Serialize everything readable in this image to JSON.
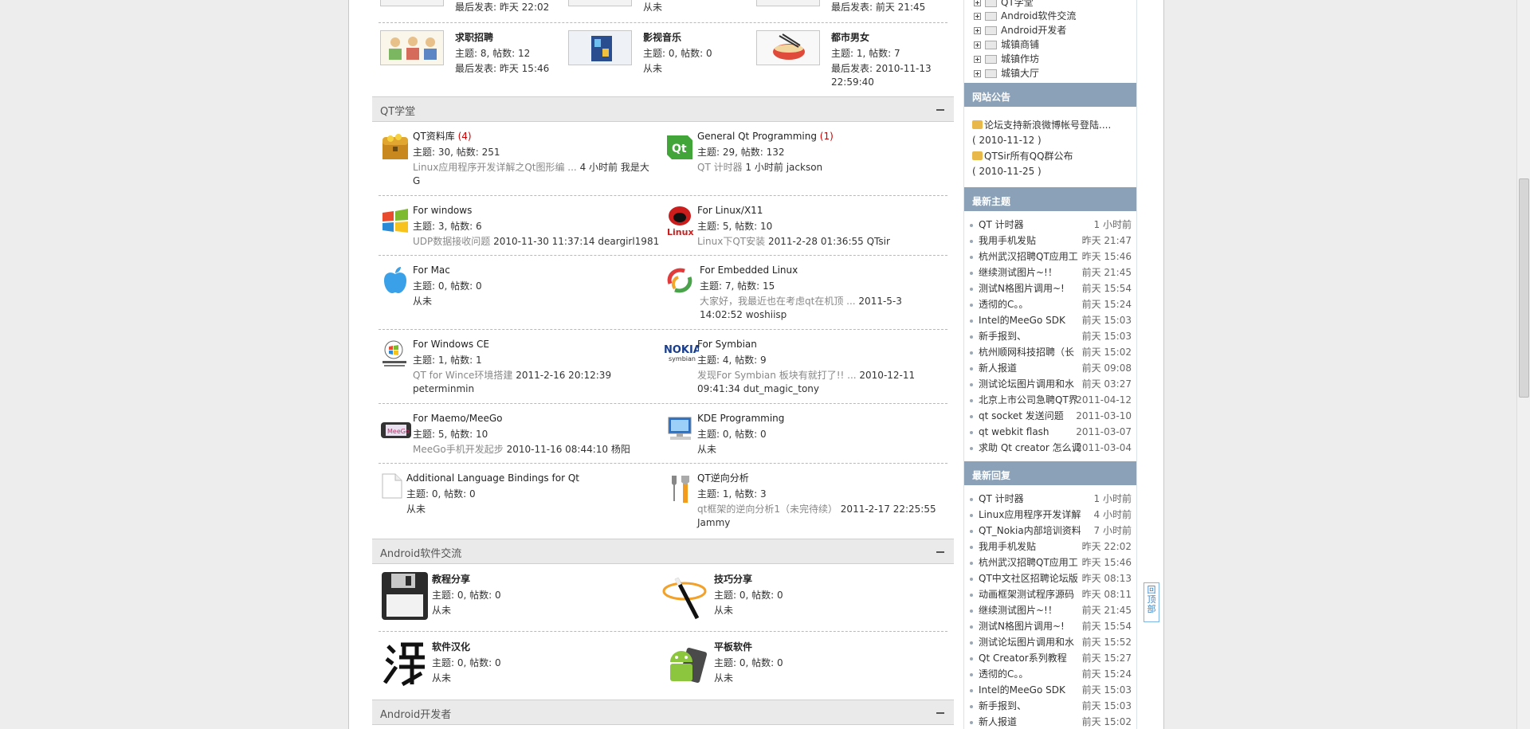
{
  "top_row": [
    {
      "last": "最后发表: 昨天 22:02"
    },
    {
      "last": "从未"
    },
    {
      "last": "最后发表: 前天 21:45"
    }
  ],
  "row2": [
    {
      "title": "求职招聘",
      "stat": "主题: 8, 帖数: 12",
      "last": "最后发表: 昨天 15:46"
    },
    {
      "title": "影视音乐",
      "stat": "主题: 0, 帖数: 0",
      "last": "从未"
    },
    {
      "title": "都市男女",
      "stat": "主题: 1, 帖数: 7",
      "last": "最后发表: 2010-11-13 22:59:40"
    }
  ],
  "qt_category": {
    "title": "QT学堂",
    "boards": [
      {
        "title": "QT资料库",
        "new": "(4)",
        "stat": "主题: 30, 帖数: 251",
        "last_thread": "Linux应用程序开发详解之Qt图形编 ...",
        "last_time": "4 小时前",
        "last_user": "我是大G"
      },
      {
        "title": "General Qt Programming",
        "new": "(1)",
        "stat": "主题: 29, 帖数: 132",
        "last_thread": "QT 计时器",
        "last_time": "1 小时前",
        "last_user": "jackson"
      },
      {
        "title": "For windows",
        "stat": "主题: 3, 帖数: 6",
        "last_thread": "UDP数据接收问题",
        "last_time": "2010-11-30 11:37:14",
        "last_user": "deargirl1981"
      },
      {
        "title": "For Linux/X11",
        "stat": "主题: 5, 帖数: 10",
        "last_thread": "Linux下QT安装",
        "last_time": "2011-2-28 01:36:55",
        "last_user": "QTsir"
      },
      {
        "title": "For Mac",
        "stat": "主题: 0, 帖数: 0",
        "last": "从未"
      },
      {
        "title": "For Embedded Linux",
        "stat": "主题: 7, 帖数: 15",
        "last_thread": "大家好，我最近也在考虑qt在机顶 ...",
        "last_time": "2011-5-3 14:02:52",
        "last_user": "woshiisp"
      },
      {
        "title": "For Windows CE",
        "stat": "主题: 1, 帖数: 1",
        "last_thread": "QT for Wince环境搭建",
        "last_time": "2011-2-16 20:12:39",
        "last_user": "peterminmin"
      },
      {
        "title": "For Symbian",
        "stat": "主题: 4, 帖数: 9",
        "last_thread": "发现For Symbian 板块有就打了!! ...",
        "last_time": "2010-12-11 09:41:34",
        "last_user": "dut_magic_tony"
      },
      {
        "title": "For Maemo/MeeGo",
        "stat": "主题: 5, 帖数: 10",
        "last_thread": "MeeGo手机开发起步",
        "last_time": "2010-11-16 08:44:10",
        "last_user": "杨阳"
      },
      {
        "title": "KDE Programming",
        "stat": "主题: 0, 帖数: 0",
        "last": "从未"
      },
      {
        "title": "Additional Language Bindings for Qt",
        "stat": "主题: 0, 帖数: 0",
        "last": "从未"
      },
      {
        "title": "QT逆向分析",
        "stat": "主题: 1, 帖数: 3",
        "last_thread": "qt框架的逆向分析1（未完待续）",
        "last_time": "2011-2-17 22:25:55",
        "last_user": "Jammy"
      }
    ]
  },
  "android_category": {
    "title": "Android软件交流",
    "boards": [
      {
        "title": "教程分享",
        "stat": "主题: 0, 帖数: 0",
        "last": "从未"
      },
      {
        "title": "技巧分享",
        "stat": "主题: 0, 帖数: 0",
        "last": "从未"
      },
      {
        "title": "软件汉化",
        "stat": "主题: 0, 帖数: 0",
        "last": "从未"
      },
      {
        "title": "平板软件",
        "stat": "主题: 0, 帖数: 0",
        "last": "从未"
      }
    ]
  },
  "android_dev_category": {
    "title": "Android开发者"
  },
  "sidebar": {
    "tree": [
      "QT学堂",
      "Android软件交流",
      "Android开发者",
      "城镇商铺",
      "城镇作坊",
      "城镇大厅"
    ],
    "notice_title": "网站公告",
    "notices": [
      {
        "text": "论坛支持新浪微博帐号登陆....",
        "date": "( 2010-11-12 )"
      },
      {
        "text": "QTSir所有QQ群公布",
        "date": "( 2010-11-25 )"
      }
    ],
    "latest_title": "最新主题",
    "latest": [
      {
        "t": "QT 计时器",
        "d": "1 小时前"
      },
      {
        "t": "我用手机发贴",
        "d": "昨天 21:47"
      },
      {
        "t": "杭州武汉招聘QT应用工",
        "d": "昨天 15:46"
      },
      {
        "t": "继续测试图片~!！",
        "d": "前天 21:45"
      },
      {
        "t": "测试N格图片调用~!",
        "d": "前天 15:54"
      },
      {
        "t": "透彻的C。。",
        "d": "前天 15:24"
      },
      {
        "t": "Intel的MeeGo SDK",
        "d": "前天 15:03"
      },
      {
        "t": "新手报到、",
        "d": "前天 15:03"
      },
      {
        "t": "杭州顺网科技招聘（长",
        "d": "前天 15:02"
      },
      {
        "t": "新人报道",
        "d": "前天 09:08"
      },
      {
        "t": "测试论坛图片调用和水",
        "d": "前天 03:27"
      },
      {
        "t": "北京上市公司急聘QT界",
        "d": "2011-04-12"
      },
      {
        "t": "qt socket 发送问题",
        "d": "2011-03-10"
      },
      {
        "t": "qt webkit flash",
        "d": "2011-03-07"
      },
      {
        "t": "求助 Qt creator 怎么调",
        "d": "2011-03-04"
      }
    ],
    "reply_title": "最新回复",
    "replies": [
      {
        "t": "QT 计时器",
        "d": "1 小时前"
      },
      {
        "t": "Linux应用程序开发详解之",
        "d": "4 小时前"
      },
      {
        "t": "QT_Nokia内部培训资料",
        "d": "7 小时前"
      },
      {
        "t": "我用手机发贴",
        "d": "昨天 22:02"
      },
      {
        "t": "杭州武汉招聘QT应用工",
        "d": "昨天 15:46"
      },
      {
        "t": "QT中文社区招聘论坛版",
        "d": "昨天 08:13"
      },
      {
        "t": "动画框架测试程序源码",
        "d": "昨天 08:11"
      },
      {
        "t": "继续测试图片~!！",
        "d": "前天 21:45"
      },
      {
        "t": "测试N格图片调用~!",
        "d": "前天 15:54"
      },
      {
        "t": "测试论坛图片调用和水",
        "d": "前天 15:52"
      },
      {
        "t": "Qt Creator系列教程",
        "d": "前天 15:27"
      },
      {
        "t": "透彻的C。。",
        "d": "前天 15:24"
      },
      {
        "t": "Intel的MeeGo SDK",
        "d": "前天 15:03"
      },
      {
        "t": "新手报到、",
        "d": "前天 15:03"
      },
      {
        "t": "新人报道",
        "d": "前天 15:02"
      }
    ]
  },
  "backtop": "回顶部"
}
